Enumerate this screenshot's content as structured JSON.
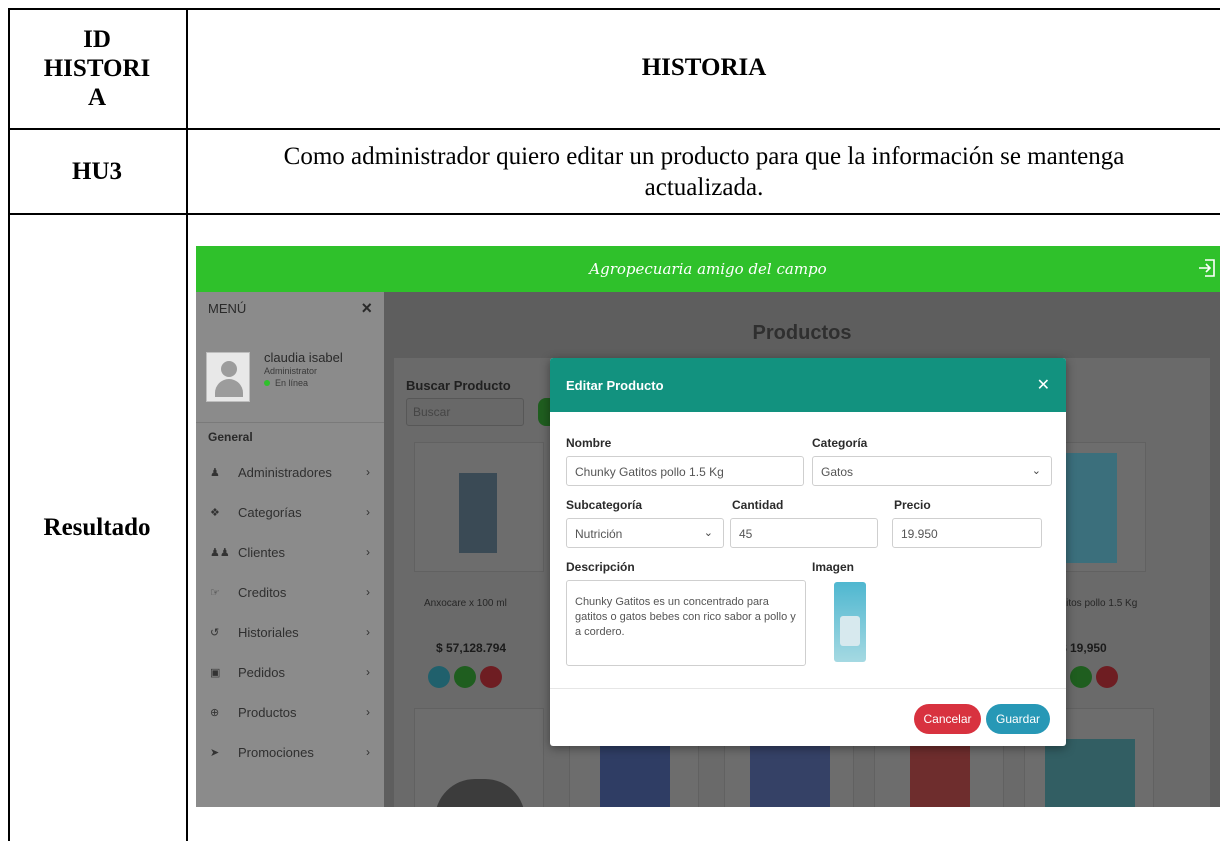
{
  "table": {
    "header_id": "ID HISTORI A",
    "header_id_lines": [
      "ID",
      "HISTORI",
      "A"
    ],
    "header_story": "HISTORIA",
    "row_id": "HU3",
    "row_text": "Como administrador quiero editar un producto para que la información se mantenga actualizada.",
    "result_label": "Resultado"
  },
  "app": {
    "brand": "Agropecuaria amigo del campo",
    "sidebar": {
      "menu_title": "MENÚ",
      "close": "×",
      "user_name": "claudia isabel",
      "user_role": "Administrator",
      "user_status": "En línea",
      "section": "General",
      "items": [
        {
          "label": "Administradores",
          "icon": "users-icon"
        },
        {
          "label": "Categorías",
          "icon": "tags-icon"
        },
        {
          "label": "Clientes",
          "icon": "people-icon"
        },
        {
          "label": "Creditos",
          "icon": "hand-money-icon"
        },
        {
          "label": "Historiales",
          "icon": "history-icon"
        },
        {
          "label": "Pedidos",
          "icon": "box-icon"
        },
        {
          "label": "Productos",
          "icon": "globe-icon"
        },
        {
          "label": "Promociones",
          "icon": "tag-icon"
        }
      ],
      "notifications": "0"
    },
    "main": {
      "title": "Productos",
      "search_label": "Buscar Producto",
      "search_placeholder": "Buscar",
      "products": [
        {
          "name": "Anxocare x 100 ml",
          "price": "$ 57,128.794"
        },
        {
          "name": "Gatitos pollo 1.5 Kg",
          "price": "$ 19,950"
        }
      ]
    },
    "modal": {
      "title": "Editar Producto",
      "labels": {
        "nombre": "Nombre",
        "categoria": "Categoría",
        "subcategoria": "Subcategoría",
        "cantidad": "Cantidad",
        "precio": "Precio",
        "descripcion": "Descripción",
        "imagen": "Imagen"
      },
      "values": {
        "nombre": "Chunky Gatitos pollo 1.5 Kg",
        "categoria": "Gatos",
        "subcategoria": "Nutrición",
        "cantidad": "45",
        "precio": "19.950",
        "descripcion": "Chunky Gatitos es un concentrado para gatitos o gatos bebes con rico sabor a pollo y a cordero."
      },
      "cancel": "Cancelar",
      "save": "Guardar"
    }
  },
  "colors": {
    "topbar": "#2fc12b",
    "modal_header": "#12927f",
    "cancel": "#d8323f",
    "save": "#2798b6"
  }
}
